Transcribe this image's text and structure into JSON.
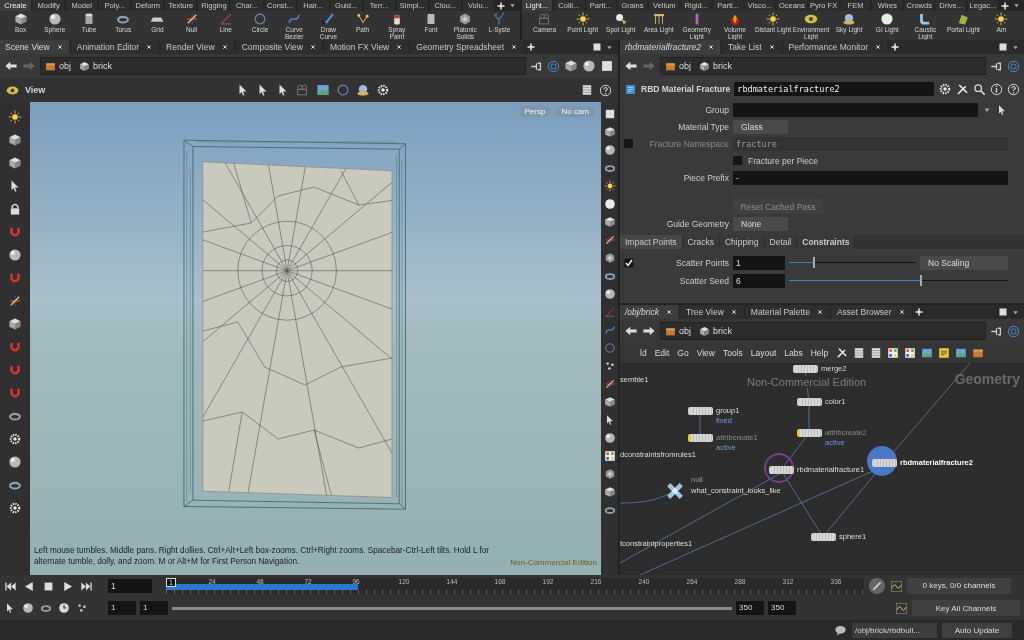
{
  "shelves": [
    {
      "tabs": [
        {
          "label": "Create",
          "selected": true
        },
        {
          "label": "Modify",
          "selected": false
        },
        {
          "label": "Model",
          "selected": false
        },
        {
          "label": "Poly...",
          "selected": false
        },
        {
          "label": "Deform",
          "selected": false
        },
        {
          "label": "Texture",
          "selected": false
        },
        {
          "label": "Rigging",
          "selected": false
        },
        {
          "label": "Char...",
          "selected": false
        },
        {
          "label": "Const...",
          "selected": false
        },
        {
          "label": "Hair...",
          "selected": false
        },
        {
          "label": "Guid...",
          "selected": false
        },
        {
          "label": "Terr...",
          "selected": false
        },
        {
          "label": "Simpl...",
          "selected": false
        },
        {
          "label": "Clou...",
          "selected": false
        },
        {
          "label": "Volu...",
          "selected": false
        }
      ],
      "tools": [
        {
          "label": "Box"
        },
        {
          "label": "Sphere"
        },
        {
          "label": "Tube"
        },
        {
          "label": "Torus"
        },
        {
          "label": "Grid"
        },
        {
          "label": "Null"
        },
        {
          "label": "Line"
        },
        {
          "label": "Circle"
        },
        {
          "label": "Curve Bezier"
        },
        {
          "label": "Draw Curve"
        },
        {
          "label": "Path"
        },
        {
          "label": "Spray Paint"
        },
        {
          "label": "Font"
        },
        {
          "label": "Platonic Solids"
        },
        {
          "label": "L-Syste"
        }
      ]
    },
    {
      "tabs": [
        {
          "label": "Light...",
          "selected": true
        },
        {
          "label": "Colli...",
          "selected": false
        },
        {
          "label": "Parti...",
          "selected": false
        },
        {
          "label": "Grains",
          "selected": false
        },
        {
          "label": "Vellum",
          "selected": false
        },
        {
          "label": "Rigid...",
          "selected": false
        },
        {
          "label": "Parti...",
          "selected": false
        },
        {
          "label": "Visco...",
          "selected": false
        },
        {
          "label": "Oceans",
          "selected": false
        },
        {
          "label": "Pyro FX",
          "selected": false
        },
        {
          "label": "FEM",
          "selected": false
        },
        {
          "label": "Wires",
          "selected": false
        },
        {
          "label": "Crowds",
          "selected": false
        },
        {
          "label": "Drive...",
          "selected": false
        },
        {
          "label": "Legac...",
          "selected": false
        }
      ],
      "tools": [
        {
          "label": "Camera"
        },
        {
          "label": "Point Light"
        },
        {
          "label": "Spot Light"
        },
        {
          "label": "Area Light"
        },
        {
          "label": "Geometry Light"
        },
        {
          "label": "Volume Light"
        },
        {
          "label": "Distant Light"
        },
        {
          "label": "Environment Light"
        },
        {
          "label": "Sky Light"
        },
        {
          "label": "GI Light"
        },
        {
          "label": "Caustic Light"
        },
        {
          "label": "Portal Light"
        },
        {
          "label": "Am"
        }
      ]
    }
  ],
  "scene_pane": {
    "tabs": [
      {
        "label": "Scene View",
        "selected": true
      },
      {
        "label": "Animation Editor",
        "selected": false
      },
      {
        "label": "Render View",
        "selected": false
      },
      {
        "label": "Composite View",
        "selected": false
      },
      {
        "label": "Motion FX View",
        "selected": false
      },
      {
        "label": "Geometry Spreadsheet",
        "selected": false
      }
    ],
    "path": [
      "obj",
      "brick"
    ],
    "toolbar_label": "View",
    "view_menus": [
      "Persp",
      "No cam"
    ],
    "help_text": "Left mouse tumbles. Middle pans. Right dollies. Ctrl+Alt+Left box-zooms. Ctrl+Right zooms. Spacebar-Ctrl-Left tilts. Hold L for alternate tumble, dolly, and zoom. M or Alt+M for First Person Navigation.",
    "edition": "Non-Commercial Edition"
  },
  "parameter_pane": {
    "tabs": [
      {
        "label": "rbdmaterialfracture2",
        "selected": true
      },
      {
        "label": "Take List",
        "selected": false
      },
      {
        "label": "Performance Monitor",
        "selected": false
      }
    ],
    "path": [
      "obj",
      "brick"
    ],
    "node_type": "RBD Material Fracture",
    "node_name": "rbdmaterialfracture2",
    "params": [
      {
        "kind": "menu_field",
        "label": "Group"
      },
      {
        "kind": "dropdown",
        "label": "Material Type",
        "value": "Glass"
      },
      {
        "kind": "text",
        "label": "Fracture Namespace",
        "placeholder": "fracture",
        "checked": false,
        "disabled": true
      },
      {
        "kind": "checkbox",
        "label": "Fracture per Piece",
        "checked": false
      },
      {
        "kind": "text",
        "label": "Piece Prefix",
        "value": "-"
      },
      {
        "kind": "button",
        "label": "Reset Cached Pass",
        "disabled": true
      },
      {
        "kind": "dropdown",
        "label": "Guide Geometry",
        "value": "None"
      }
    ],
    "folder_tabs": [
      {
        "label": "Impact Points",
        "selected": true,
        "modified": false
      },
      {
        "label": "Cracks",
        "selected": false,
        "modified": false
      },
      {
        "label": "Chipping",
        "selected": false,
        "modified": false
      },
      {
        "label": "Detail",
        "selected": false,
        "modified": false
      },
      {
        "label": "Constraints",
        "selected": false,
        "modified": true
      }
    ],
    "folder_params": [
      {
        "label": "Scatter Points",
        "value": "1",
        "checked": true,
        "level": 0.19,
        "menu": "No Scaling"
      },
      {
        "label": "Scatter Seed",
        "value": "6",
        "level": 0.6
      }
    ]
  },
  "network_pane": {
    "tabs": [
      {
        "label": "/obj/brick",
        "selected": true
      },
      {
        "label": "Tree View",
        "selected": false
      },
      {
        "label": "Material Palette",
        "selected": false
      },
      {
        "label": "Asset Browser",
        "selected": false
      }
    ],
    "path": [
      "obj",
      "brick"
    ],
    "menu": [
      "ld",
      "Edit",
      "Go",
      "View",
      "Tools",
      "Layout",
      "Labs",
      "Help"
    ],
    "watermark": "Non-Commercial Edition",
    "context": "Geometry",
    "nodes": [
      {
        "kind": "node",
        "name": "merge2",
        "bypassed": false
      },
      {
        "kind": "cut",
        "name": "semble1"
      },
      {
        "kind": "node",
        "name": "group1",
        "sub": "fixed",
        "bypassed": false
      },
      {
        "kind": "node",
        "name": "color1",
        "bypassed": false
      },
      {
        "kind": "node",
        "name": "attribcreate1",
        "sub": "active",
        "bypassed": true
      },
      {
        "kind": "node",
        "name": "attribcreate2",
        "sub": "active",
        "bypassed": true
      },
      {
        "kind": "cut",
        "name": "dconstraintsfromrules1"
      },
      {
        "kind": "ringed",
        "name": "rbdmaterialfracture1",
        "selected": false,
        "bypassed": false
      },
      {
        "kind": "ringed",
        "name": "rbdmaterialfracture2",
        "selected": true,
        "bypassed": false
      },
      {
        "kind": "null",
        "name": "what_constraint_looks_like",
        "sub": "null"
      },
      {
        "kind": "node",
        "name": "sphere1",
        "bypassed": false
      },
      {
        "kind": "cut",
        "name": "tconstraintproperties1"
      }
    ]
  },
  "timeline": {
    "frame": "1",
    "marker": "1",
    "ticks": [
      "24",
      "48",
      "72",
      "96",
      "120",
      "144",
      "168",
      "192",
      "216",
      "240",
      "264",
      "288",
      "312",
      "336"
    ],
    "cache": {
      "level": 0.275
    },
    "start": "1",
    "start_range": "1",
    "end_range": "350",
    "end": "350",
    "keys": "0 keys, 0/0 channels",
    "key_button": "Key All Channels"
  },
  "status_bar": {
    "path": "/obj/brick/rbdbull...",
    "update": "Auto Update"
  }
}
